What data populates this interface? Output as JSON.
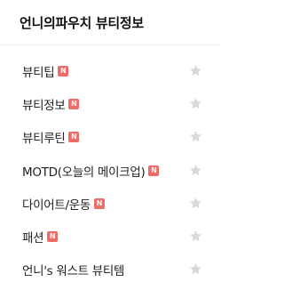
{
  "panel": {
    "title": "언니의파우치 뷰티정보"
  },
  "colors": {
    "badge_bg": "#ee6b67",
    "star": "#d9d9d9"
  },
  "items": [
    {
      "label": "뷰티팁",
      "badge": "N",
      "icon": "star-icon"
    },
    {
      "label": "뷰티정보",
      "badge": "N",
      "icon": "star-icon"
    },
    {
      "label": "뷰티루틴",
      "badge": "N",
      "icon": "star-icon"
    },
    {
      "label": "MOTD(오늘의 메이크업)",
      "badge": "N",
      "icon": "star-icon"
    },
    {
      "label": "다이어트/운동",
      "badge": "N",
      "icon": "star-icon"
    },
    {
      "label": "패션",
      "badge": "N",
      "icon": "star-icon"
    },
    {
      "label": "언니's 워스트 뷰티템",
      "badge": "",
      "icon": "star-icon"
    }
  ]
}
